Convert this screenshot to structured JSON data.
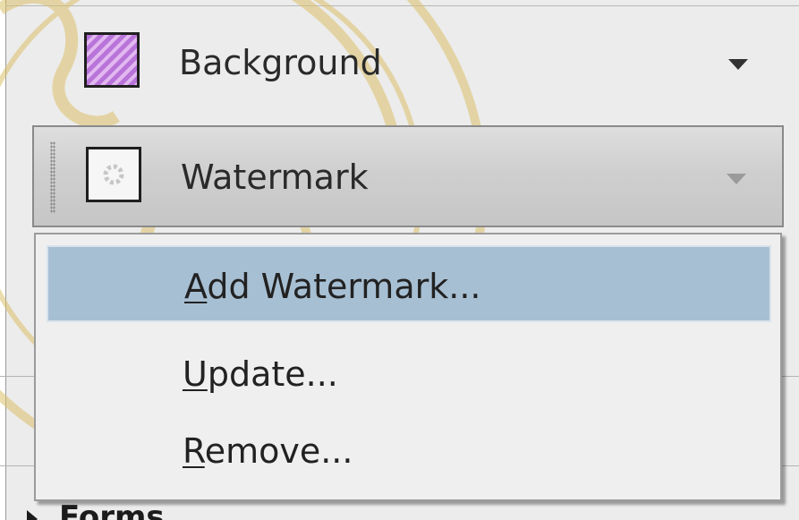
{
  "tools": {
    "background": {
      "label": "Background",
      "icon": "background-pattern-icon"
    },
    "watermark": {
      "label": "Watermark",
      "icon": "watermark-icon"
    }
  },
  "menu": {
    "items": [
      {
        "label": "Add Watermark...",
        "accel": "A",
        "rest": "dd Watermark...",
        "highlighted": true
      },
      {
        "label": "Update...",
        "accel": "U",
        "rest": "pdate..."
      },
      {
        "label": "Remove...",
        "accel": "R",
        "rest": "emove..."
      }
    ]
  },
  "section_below": {
    "label": "Forms"
  },
  "colors": {
    "highlight": "#a7bfd3",
    "background_icon": "#b874d9",
    "watermark_logo": "#d9b24a"
  }
}
